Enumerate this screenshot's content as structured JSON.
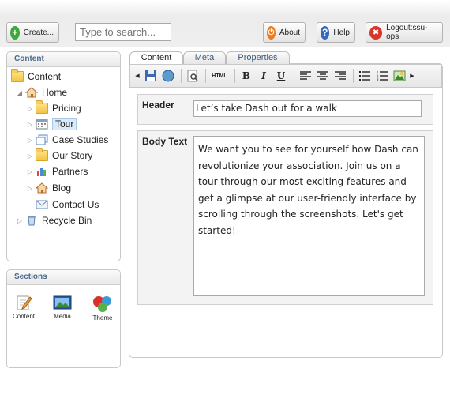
{
  "header": {
    "create_label": "Create...",
    "search_placeholder": "Type to search...",
    "about_label": "About",
    "help_label": "Help",
    "logout_label": "Logout:ssu-ops"
  },
  "content_panel": {
    "title": "Content",
    "tree": [
      {
        "label": "Content",
        "icon": "folder-icon"
      },
      {
        "label": "Home",
        "icon": "home-icon"
      },
      {
        "label": "Pricing",
        "icon": "folder-icon"
      },
      {
        "label": "Tour",
        "icon": "calendar-icon"
      },
      {
        "label": "Case Studies",
        "icon": "pages-icon"
      },
      {
        "label": "Our Story",
        "icon": "folder-icon"
      },
      {
        "label": "Partners",
        "icon": "chart-icon"
      },
      {
        "label": "Blog",
        "icon": "home-icon"
      },
      {
        "label": "Contact Us",
        "icon": "mail-icon"
      },
      {
        "label": "Recycle Bin",
        "icon": "recycle-bin-icon"
      }
    ]
  },
  "sections_panel": {
    "title": "Sections",
    "items": [
      {
        "label": "Content",
        "icon": "edit-icon"
      },
      {
        "label": "Media",
        "icon": "media-icon"
      },
      {
        "label": "Theme",
        "icon": "theme-icon"
      }
    ]
  },
  "editor": {
    "tabs": [
      "Content",
      "Meta",
      "Properties"
    ],
    "active_tab": "Content",
    "toolbar": {
      "html_label": "HTML",
      "bold_label": "B",
      "italic_label": "I",
      "underline_label": "U"
    },
    "header_label": "Header",
    "header_value": "Let’s take Dash out for a walk",
    "body_label": "Body Text",
    "body_value": "We want you to see for yourself how Dash can revolutionize your association. Join us on a tour through our most exciting features and get a glimpse at our user-friendly interface by scrolling through the screenshots. Let's get started!"
  },
  "colors": {
    "create_icon": "#3ea83c",
    "about_icon": "#f07a1a",
    "help_icon": "#3468b8",
    "logout_icon": "#d9362b",
    "panel_title": "#4a6a8a"
  }
}
